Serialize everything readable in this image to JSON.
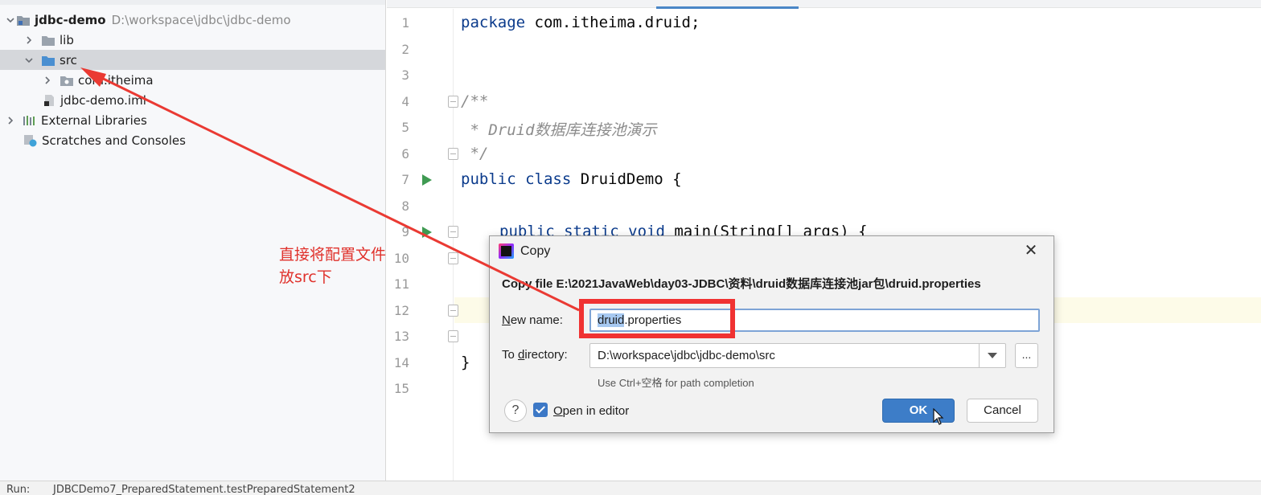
{
  "project_tree": {
    "root": {
      "name": "jdbc-demo",
      "path": "D:\\workspace\\jdbc\\jdbc-demo"
    },
    "items": [
      {
        "label": "lib"
      },
      {
        "label": "src"
      },
      {
        "label": "com.itheima"
      },
      {
        "label": "jdbc-demo.iml"
      },
      {
        "label": "External Libraries"
      },
      {
        "label": "Scratches and Consoles"
      }
    ]
  },
  "editor": {
    "line_numbers": [
      "1",
      "2",
      "3",
      "4",
      "5",
      "6",
      "7",
      "8",
      "9",
      "10",
      "11",
      "12",
      "13",
      "14",
      "15"
    ],
    "code": {
      "line1_kw": "package",
      "line1_rest": " com.itheima.druid;",
      "line4": "/**",
      "line5": " * Druid数据库连接池演示",
      "line6": " */",
      "line7_kw": "public class",
      "line7_rest": " DruidDemo {",
      "line9_kw": "public static void",
      "line9_rest": " main(String[] args) {",
      "line14": "}"
    }
  },
  "annotation": {
    "line1": "直接将配置文件",
    "line2": "放src下"
  },
  "dialog": {
    "title": "Copy",
    "close_glyph": "✕",
    "description": "Copy file E:\\2021JavaWeb\\day03-JDBC\\资料\\druid数据库连接池jar包\\druid.properties",
    "new_name_mnemonic": "N",
    "new_name_rest": "ew name:",
    "new_name_value_selected": "druid",
    "new_name_value_rest": ".properties",
    "to_dir_prefix": "To ",
    "to_dir_mnemonic": "d",
    "to_dir_rest": "irectory:",
    "to_dir_value": "D:\\workspace\\jdbc\\jdbc-demo\\src",
    "browse_label": "...",
    "path_hint": "Use Ctrl+空格 for path completion",
    "help_label": "?",
    "open_in_editor_mnemonic": "O",
    "open_in_editor_rest": "pen in editor",
    "open_in_editor_checked": true,
    "ok_label": "OK",
    "cancel_label": "Cancel"
  },
  "run_bar": {
    "label": "Run:",
    "item": "JDBCDemo7_PreparedStatement.testPreparedStatement2"
  },
  "colors": {
    "accent": "#3d7dc8",
    "annotation_red": "#e0312b",
    "run_green": "#3f9a52"
  }
}
